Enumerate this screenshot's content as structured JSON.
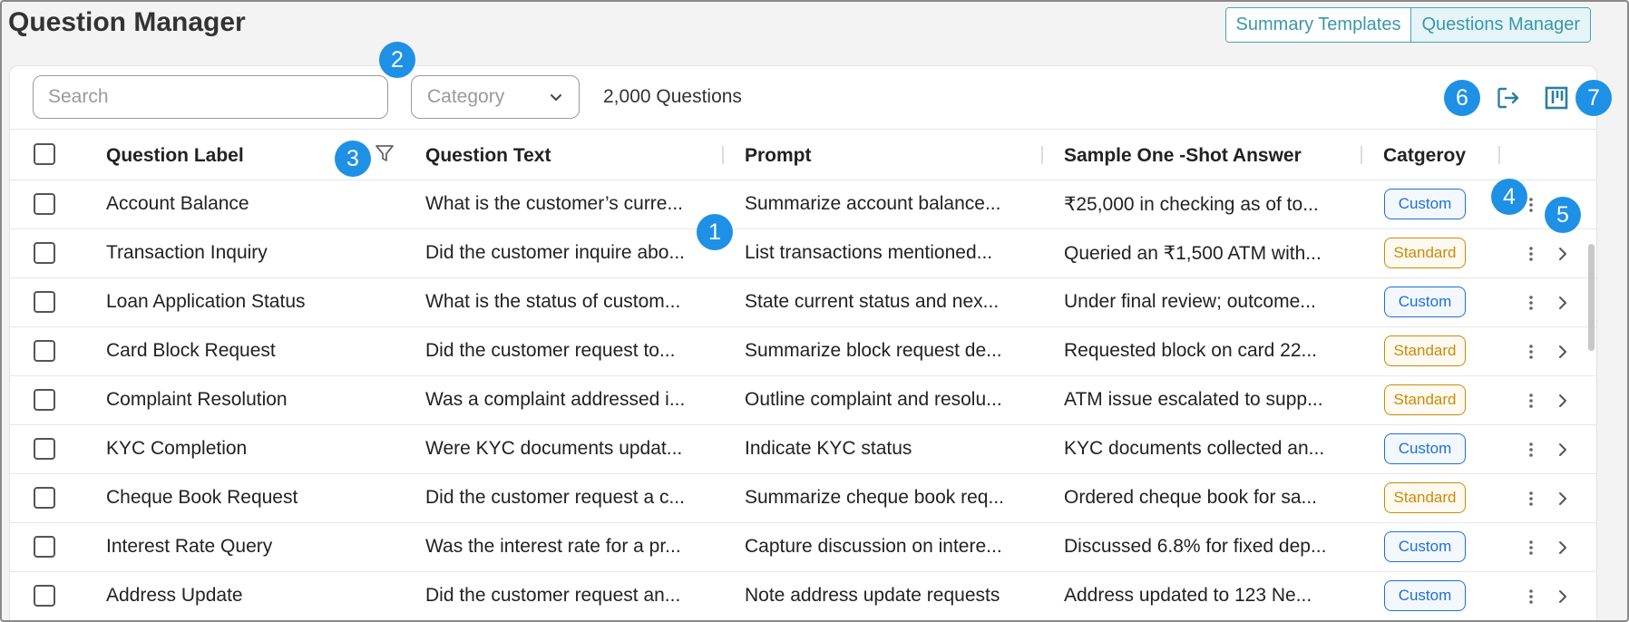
{
  "header": {
    "title": "Question Manager",
    "tabs": [
      {
        "label": "Summary Templates",
        "active": false
      },
      {
        "label": "Questions Manager",
        "active": true
      }
    ]
  },
  "toolbar": {
    "search_placeholder": "Search",
    "category_placeholder": "Category",
    "category_icon": "chevron-down-icon",
    "count_text": "2,000 Questions",
    "export_icon": "export-icon",
    "board_icon": "board-layout-icon"
  },
  "table": {
    "columns": [
      "Question Label",
      "Question Text",
      "Prompt",
      "Sample One -Shot Answer",
      "Catgeroy"
    ],
    "filter_icon": "filter-icon",
    "rows": [
      {
        "label": "Account Balance",
        "text": "What is the customer’s curre...",
        "prompt": "Summarize account balance...",
        "answer": "₹25,000 in checking as of to...",
        "category": "Custom"
      },
      {
        "label": "Transaction Inquiry",
        "text": "Did the customer inquire abo...",
        "prompt": "List transactions mentioned...",
        "answer": "Queried an ₹1,500 ATM with...",
        "category": "Standard"
      },
      {
        "label": "Loan Application Status",
        "text": "What is the status of custom...",
        "prompt": "State current status and nex...",
        "answer": "Under final review; outcome...",
        "category": "Custom"
      },
      {
        "label": "Card Block Request",
        "text": "Did the customer request to...",
        "prompt": "Summarize block request de...",
        "answer": "Requested block on card 22...",
        "category": "Standard"
      },
      {
        "label": "Complaint Resolution",
        "text": "Was a complaint addressed i...",
        "prompt": "Outline complaint and resolu...",
        "answer": "ATM issue escalated to supp...",
        "category": "Standard"
      },
      {
        "label": "KYC Completion",
        "text": "Were KYC documents updat...",
        "prompt": "Indicate KYC status",
        "answer": "KYC documents collected an...",
        "category": "Custom"
      },
      {
        "label": "Cheque Book Request",
        "text": "Did the customer request a c...",
        "prompt": "Summarize cheque book req...",
        "answer": "Ordered cheque book for sa...",
        "category": "Standard"
      },
      {
        "label": "Interest Rate Query",
        "text": "Was the interest rate for a pr...",
        "prompt": "Capture discussion on intere...",
        "answer": "Discussed 6.8% for fixed dep...",
        "category": "Custom"
      },
      {
        "label": "Address Update",
        "text": "Did the customer request an...",
        "prompt": "Note address update requests",
        "answer": "Address updated to 123 Ne...",
        "category": "Custom"
      }
    ]
  },
  "markers": [
    "1",
    "2",
    "3",
    "4",
    "5",
    "6",
    "7"
  ],
  "colors": {
    "accent": "#3a97aa",
    "marker": "#1e90e6",
    "custom_badge": "#1f6fd6",
    "standard_badge": "#c98a0a"
  }
}
